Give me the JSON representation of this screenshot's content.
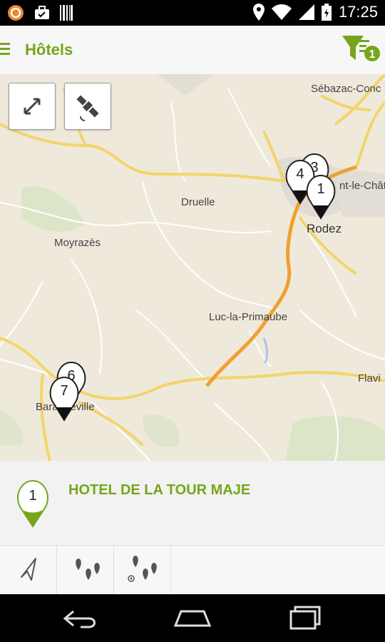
{
  "status_bar": {
    "time": "17:25",
    "icons": [
      "notification-icon",
      "briefcase-icon",
      "barcode-icon",
      "location-icon",
      "wifi-icon",
      "signal-icon",
      "battery-icon"
    ]
  },
  "app_bar": {
    "title": "Hôtels",
    "filter_badge": "1",
    "accent_color": "#76a51c"
  },
  "map": {
    "places": [
      "Sébazac-Conc",
      "nt-le-Châte",
      "Druelle",
      "Rodez",
      "Moyrazès",
      "Luc-la-Primaube",
      "Flavi",
      "Baraqueville"
    ],
    "markers": [
      "3",
      "4",
      "1",
      "6",
      "7"
    ],
    "controls": [
      "fullscreen-icon",
      "satellite-icon"
    ]
  },
  "selected_hotel": {
    "number": "1",
    "name": "HOTEL DE LA TOUR MAJE"
  },
  "toolbar": {
    "buttons": [
      "navigate-icon",
      "map-markers-icon",
      "nearby-markers-icon"
    ]
  },
  "nav_bar": {
    "buttons": [
      "back-icon",
      "home-icon",
      "recents-icon"
    ]
  }
}
